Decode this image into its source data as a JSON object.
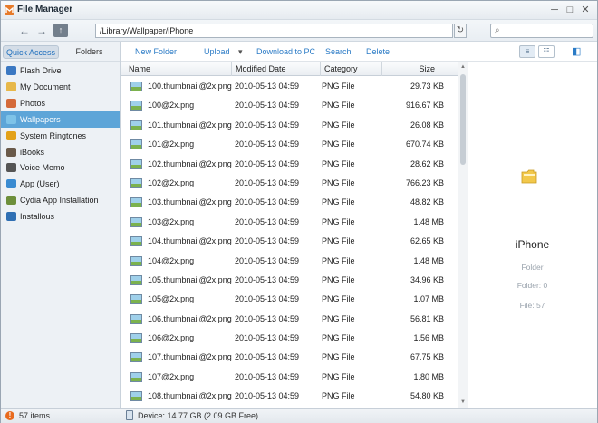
{
  "window": {
    "title": "File Manager",
    "min": "─",
    "max": "□",
    "close": "✕"
  },
  "toolbar": {
    "back": "←",
    "forward": "→",
    "up": "↑",
    "path": "/Library/Wallpaper/iPhone",
    "refresh": "↻",
    "search_icon": "⌕",
    "search_value": ""
  },
  "sidebar": {
    "tabs": {
      "quick_access": "Quick Access",
      "folders": "Folders"
    },
    "items": [
      {
        "label": "Flash Drive",
        "icon": "flash-drive-icon",
        "color": "#3b78c2"
      },
      {
        "label": "My Document",
        "icon": "folder-icon",
        "color": "#e7b84a"
      },
      {
        "label": "Photos",
        "icon": "photos-icon",
        "color": "#d46a3a"
      },
      {
        "label": "Wallpapers",
        "icon": "wallpaper-icon",
        "color": "#7ec3e8"
      },
      {
        "label": "System Ringtones",
        "icon": "music-icon",
        "color": "#e3a21a"
      },
      {
        "label": "iBooks",
        "icon": "book-icon",
        "color": "#6a5a4a"
      },
      {
        "label": "Voice Memo",
        "icon": "voice-memo-icon",
        "color": "#555555"
      },
      {
        "label": "App (User)",
        "icon": "app-icon",
        "color": "#3a8bd1"
      },
      {
        "label": "Cydia App Installation",
        "icon": "cydia-icon",
        "color": "#6d8f3b"
      },
      {
        "label": "Installous",
        "icon": "installous-icon",
        "color": "#2f6fb3"
      }
    ],
    "selected_index": 3
  },
  "actions": {
    "new_folder": "New Folder",
    "upload": "Upload",
    "upload_arrow": "▾",
    "download": "Download to PC",
    "search": "Search",
    "delete": "Delete",
    "view_list": "≡",
    "view_detail": "☷",
    "panel_toggle": "◧"
  },
  "table": {
    "headers": {
      "name": "Name",
      "modified": "Modified Date",
      "category": "Category",
      "size": "Size"
    },
    "rows": [
      {
        "name": "100.thumbnail@2x.png",
        "date": "2010-05-13 04:59",
        "category": "PNG File",
        "size": "29.73 KB"
      },
      {
        "name": "100@2x.png",
        "date": "2010-05-13 04:59",
        "category": "PNG File",
        "size": "916.67 KB"
      },
      {
        "name": "101.thumbnail@2x.png",
        "date": "2010-05-13 04:59",
        "category": "PNG File",
        "size": "26.08 KB"
      },
      {
        "name": "101@2x.png",
        "date": "2010-05-13 04:59",
        "category": "PNG File",
        "size": "670.74 KB"
      },
      {
        "name": "102.thumbnail@2x.png",
        "date": "2010-05-13 04:59",
        "category": "PNG File",
        "size": "28.62 KB"
      },
      {
        "name": "102@2x.png",
        "date": "2010-05-13 04:59",
        "category": "PNG File",
        "size": "766.23 KB"
      },
      {
        "name": "103.thumbnail@2x.png",
        "date": "2010-05-13 04:59",
        "category": "PNG File",
        "size": "48.82 KB"
      },
      {
        "name": "103@2x.png",
        "date": "2010-05-13 04:59",
        "category": "PNG File",
        "size": "1.48 MB"
      },
      {
        "name": "104.thumbnail@2x.png",
        "date": "2010-05-13 04:59",
        "category": "PNG File",
        "size": "62.65 KB"
      },
      {
        "name": "104@2x.png",
        "date": "2010-05-13 04:59",
        "category": "PNG File",
        "size": "1.48 MB"
      },
      {
        "name": "105.thumbnail@2x.png",
        "date": "2010-05-13 04:59",
        "category": "PNG File",
        "size": "34.96 KB"
      },
      {
        "name": "105@2x.png",
        "date": "2010-05-13 04:59",
        "category": "PNG File",
        "size": "1.07 MB"
      },
      {
        "name": "106.thumbnail@2x.png",
        "date": "2010-05-13 04:59",
        "category": "PNG File",
        "size": "56.81 KB"
      },
      {
        "name": "106@2x.png",
        "date": "2010-05-13 04:59",
        "category": "PNG File",
        "size": "1.56 MB"
      },
      {
        "name": "107.thumbnail@2x.png",
        "date": "2010-05-13 04:59",
        "category": "PNG File",
        "size": "67.75 KB"
      },
      {
        "name": "107@2x.png",
        "date": "2010-05-13 04:59",
        "category": "PNG File",
        "size": "1.80 MB"
      },
      {
        "name": "108.thumbnail@2x.png",
        "date": "2010-05-13 04:59",
        "category": "PNG File",
        "size": "54.80 KB"
      }
    ]
  },
  "scroll": {
    "up": "▲",
    "down": "▼"
  },
  "detail": {
    "name": "iPhone",
    "type": "Folder",
    "folder_count": "Folder: 0",
    "file_count": "File: 57"
  },
  "status": {
    "items": "57 items",
    "device": "Device: 14.77 GB (2.09 GB Free)",
    "warn_icon": "!"
  },
  "colors": {
    "accent": "#2b7bc6",
    "selection": "#5da5d8",
    "warning": "#e86a1e"
  }
}
